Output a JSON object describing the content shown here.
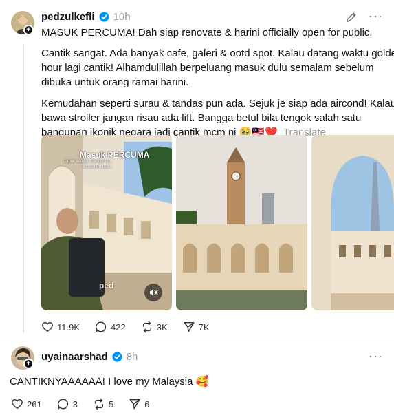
{
  "main_post": {
    "username": "pedzulkefli",
    "time": "10h",
    "first_line": "MASUK PERCUMA! Dah siap renovate & harini officially open for public.",
    "paragraph2": [
      "Cantik sangat. Ada banyak cafe, galeri & ootd spot. Kalau datang waktu golden",
      "hour lagi cantik! Alhamdulillah berpeluang masuk dulu semalam sebelum",
      "dibuka untuk orang ramai harini."
    ],
    "paragraph3": [
      "Kemudahan seperti surau & tandas pun ada. Sejuk je siap ada aircond! Kalau",
      "bawa stroller jangan risau ada lift. Bangga betul bila tengok salah satu",
      "bangunan ikonik negara jadi cantik mcm ni 🥹🇲🇾❤️"
    ],
    "translate_label": "Translate",
    "media_caption_title": "Masuk PERCUMA",
    "media_caption_sub1": "Cantik sangat. Bangunan...",
    "media_caption_sub2": "& boleh masuk...",
    "media_watermark": "ped",
    "stats": {
      "likes": "11.9K",
      "comments": "422",
      "reposts": "3K",
      "shares": "7K"
    }
  },
  "reply_post": {
    "username": "uyainaarshad",
    "time": "8h",
    "text": "CANTIKNYAAAAAA! I love my Malaysia 🥰",
    "stats": {
      "likes": "261",
      "comments": "3",
      "reposts": "5",
      "shares": "6"
    }
  },
  "colors": {
    "verified_blue": "#0095f6",
    "text": "#101010",
    "muted": "#999999"
  }
}
